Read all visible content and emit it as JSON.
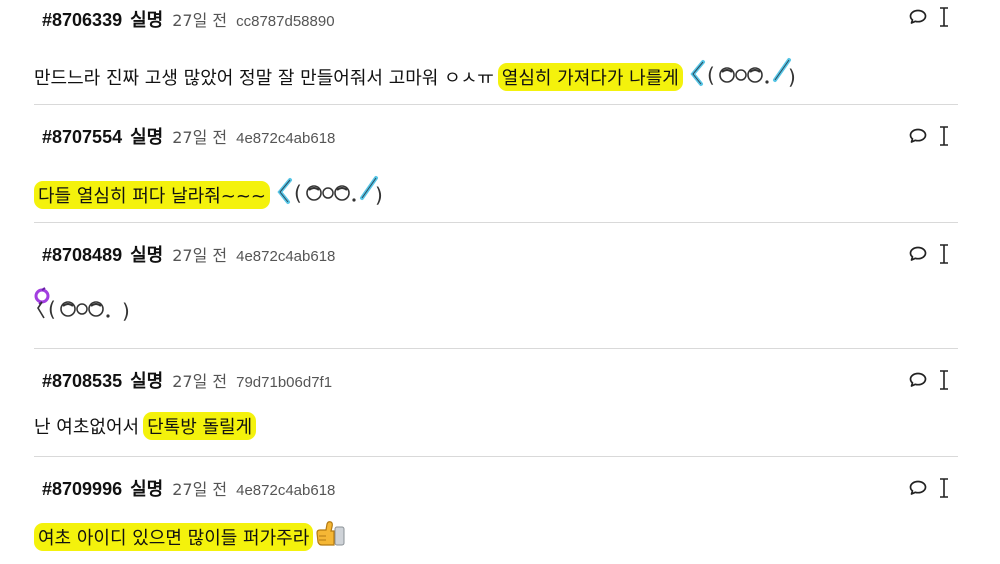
{
  "comments": [
    {
      "number": "#8706339",
      "author": "실명",
      "time": "27일 전",
      "hash": "cc8787d58890",
      "text": "만드느라 진짜 고생 많았어 정말 잘 만들어줘서 고마워 ㅇㅅㅠ",
      "highlight": "열심히 가져다가 나를게",
      "emoticon": "cheer-sticker"
    },
    {
      "number": "#8707554",
      "author": "실명",
      "time": "27일 전",
      "hash": "4e872c4ab618",
      "text": "",
      "highlight": "다들 열심히 퍼다 날라줘~~~",
      "emoticon": "cheer-sticker"
    },
    {
      "number": "#8708489",
      "author": "실명",
      "time": "27일 전",
      "hash": "4e872c4ab618",
      "text": "",
      "highlight": "",
      "emoticon": "cheer-sticker-purple"
    },
    {
      "number": "#8708535",
      "author": "실명",
      "time": "27일 전",
      "hash": "79d71b06d7f1",
      "text": "난 여초없어서",
      "highlight": "단톡방 돌릴게",
      "emoticon": ""
    },
    {
      "number": "#8709996",
      "author": "실명",
      "time": "27일 전",
      "hash": "4e872c4ab618",
      "text": "",
      "highlight": "여초 아이디 있으면 많이들 퍼가주라",
      "emoticon": "thumbs-up"
    }
  ],
  "colors": {
    "highlight": "#f4f20c",
    "divider": "#d9d9d9"
  },
  "icons": [
    "reply-bubble-icon",
    "text-cursor-icon"
  ]
}
